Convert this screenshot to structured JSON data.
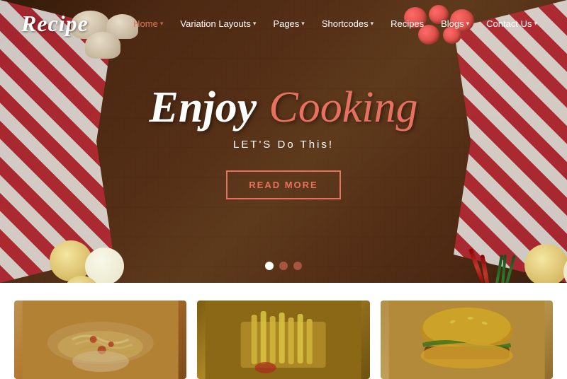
{
  "logo": "Recipe",
  "nav": {
    "items": [
      {
        "label": "Home",
        "active": true,
        "has_dropdown": true
      },
      {
        "label": "Variation Layouts",
        "active": false,
        "has_dropdown": true
      },
      {
        "label": "Pages",
        "active": false,
        "has_dropdown": true
      },
      {
        "label": "Shortcodes",
        "active": false,
        "has_dropdown": true
      },
      {
        "label": "Recipes",
        "active": false,
        "has_dropdown": false
      },
      {
        "label": "Blogs",
        "active": false,
        "has_dropdown": true
      },
      {
        "label": "Contact Us",
        "active": false,
        "has_dropdown": true
      }
    ]
  },
  "hero": {
    "title_part1": "Enjoy",
    "title_part2": "Cooking",
    "subtitle": "LET'S Do This!",
    "button_label": "READ MORE"
  },
  "slider": {
    "dots": [
      {
        "state": "active"
      },
      {
        "state": "semi"
      },
      {
        "state": "semi"
      }
    ]
  },
  "food_cards": [
    {
      "id": 1,
      "alt": "Creamy pasta dish"
    },
    {
      "id": 2,
      "alt": "French fries"
    },
    {
      "id": 3,
      "alt": "Burger"
    }
  ]
}
